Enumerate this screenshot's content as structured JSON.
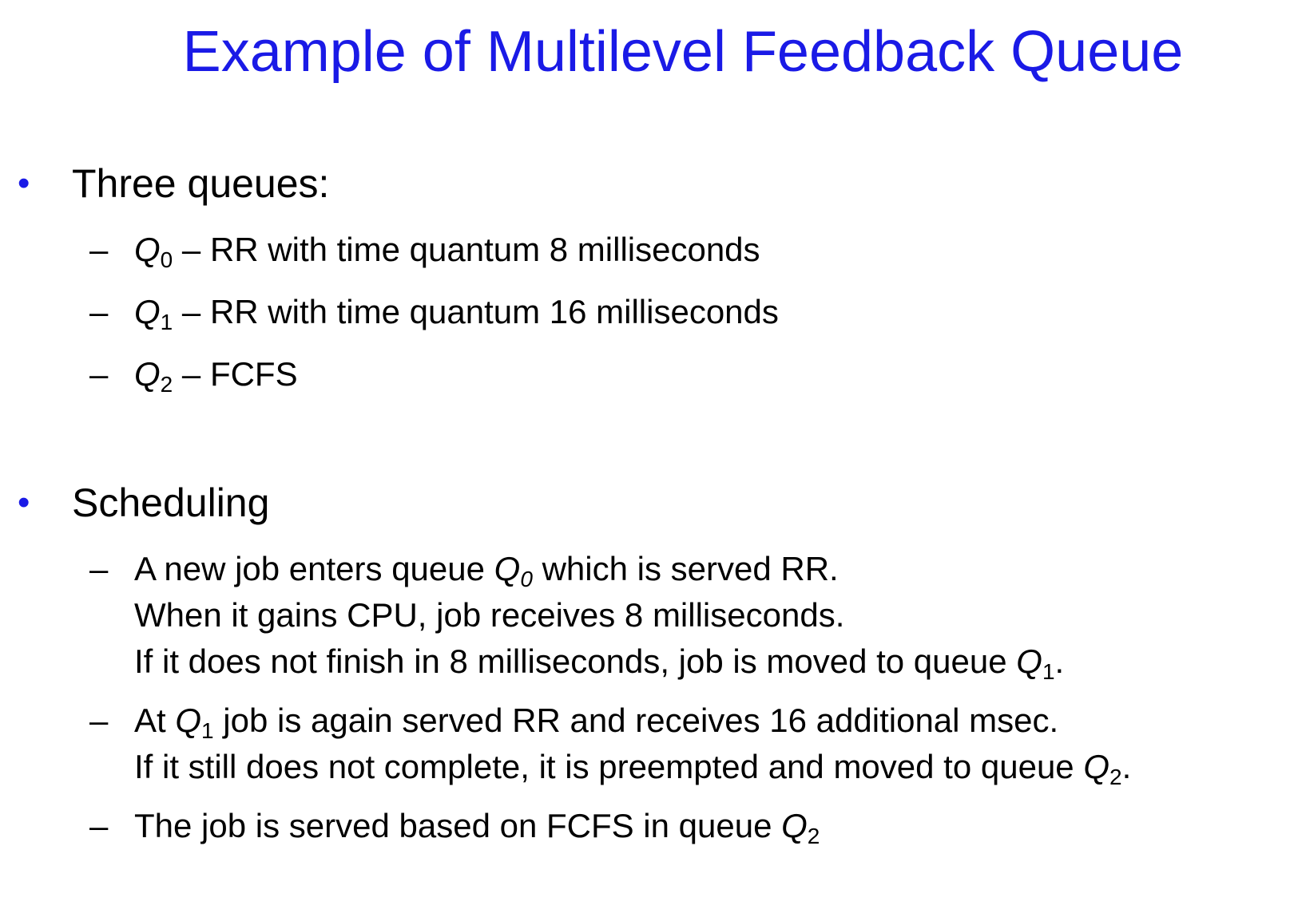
{
  "title": "Example of Multilevel Feedback Queue",
  "bullet_glyph": "•",
  "dash_glyph": "–",
  "colors": {
    "title": "#1a1ae6",
    "bullet": "#1a1ae6",
    "text": "#000000"
  },
  "sections": [
    {
      "heading": "Three queues:",
      "items": [
        {
          "q": "Q",
          "sub": "0",
          "text": " – RR with time quantum 8 milliseconds"
        },
        {
          "q": "Q",
          "sub": "1",
          "text": " – RR with time quantum 16 milliseconds"
        },
        {
          "q": "Q",
          "sub": "2",
          "text": " – FCFS"
        }
      ]
    },
    {
      "heading": "Scheduling",
      "items": [
        {
          "line1_pre": "A new job enters queue ",
          "line1_q": "Q",
          "line1_sub": "0",
          "line1_post": " which is served RR.",
          "line2": "When it gains CPU, job receives 8 milliseconds.",
          "line3_pre": "If it does not finish in 8 milliseconds, job is moved to queue ",
          "line3_q": "Q",
          "line3_sub": "1",
          "line3_post": "."
        },
        {
          "line1_pre": "At ",
          "line1_q": "Q",
          "line1_sub": "1",
          "line1_post": " job is again served RR and receives 16 additional msec.",
          "line2_pre": "If it still does not complete, it is preempted and moved to queue ",
          "line2_q": "Q",
          "line2_sub": "2",
          "line2_post": "."
        },
        {
          "line1_pre": "The job is served based on FCFS in queue ",
          "line1_q": "Q",
          "line1_sub": "2"
        }
      ]
    }
  ]
}
